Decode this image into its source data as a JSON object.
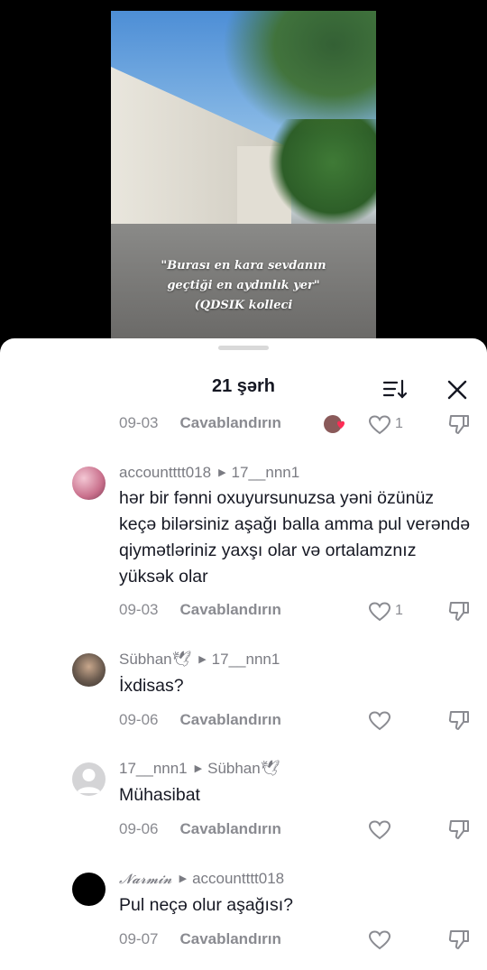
{
  "video": {
    "caption_lines": [
      "\"Burası en kara sevdanın",
      "geçtiği en aydınlık yer\"",
      "(QDSIK kolleci"
    ]
  },
  "sheet": {
    "title": "21 şərh"
  },
  "partial_comment": {
    "date": "09-03",
    "reply_label": "Cavablandırın",
    "like_count": "1"
  },
  "comments": [
    {
      "author": "accountttt018",
      "reply_to": "17__nnn1",
      "text": "hər bir fənni oxuyursunuzsa yəni özünüz keçə bilərsiniz aşağı balla amma pul verəndə qiymətləriniz yaxşı olar və ortalamznız yüksək olar",
      "date": "09-03",
      "reply_label": "Cavablandırın",
      "like_count": "1"
    },
    {
      "author": "Sübhan🕊",
      "reply_to": "17__nnn1",
      "text": "İxdisas?",
      "date": "09-06",
      "reply_label": "Cavablandırın",
      "like_count": ""
    },
    {
      "author": "17__nnn1",
      "reply_to": "Sübhan🕊",
      "text": "Mühasibat",
      "date": "09-06",
      "reply_label": "Cavablandırın",
      "like_count": ""
    },
    {
      "author": "𝓝𝓪𝓻𝓶𝓲𝓷",
      "reply_to": "accountttt018",
      "text": "Pul neçə olur aşağısı?",
      "date": "09-07",
      "reply_label": "Cavablandırın",
      "like_count": ""
    }
  ],
  "colors": {
    "text": "#161823",
    "muted": "#8a8b91",
    "sheet": "#ffffff"
  }
}
